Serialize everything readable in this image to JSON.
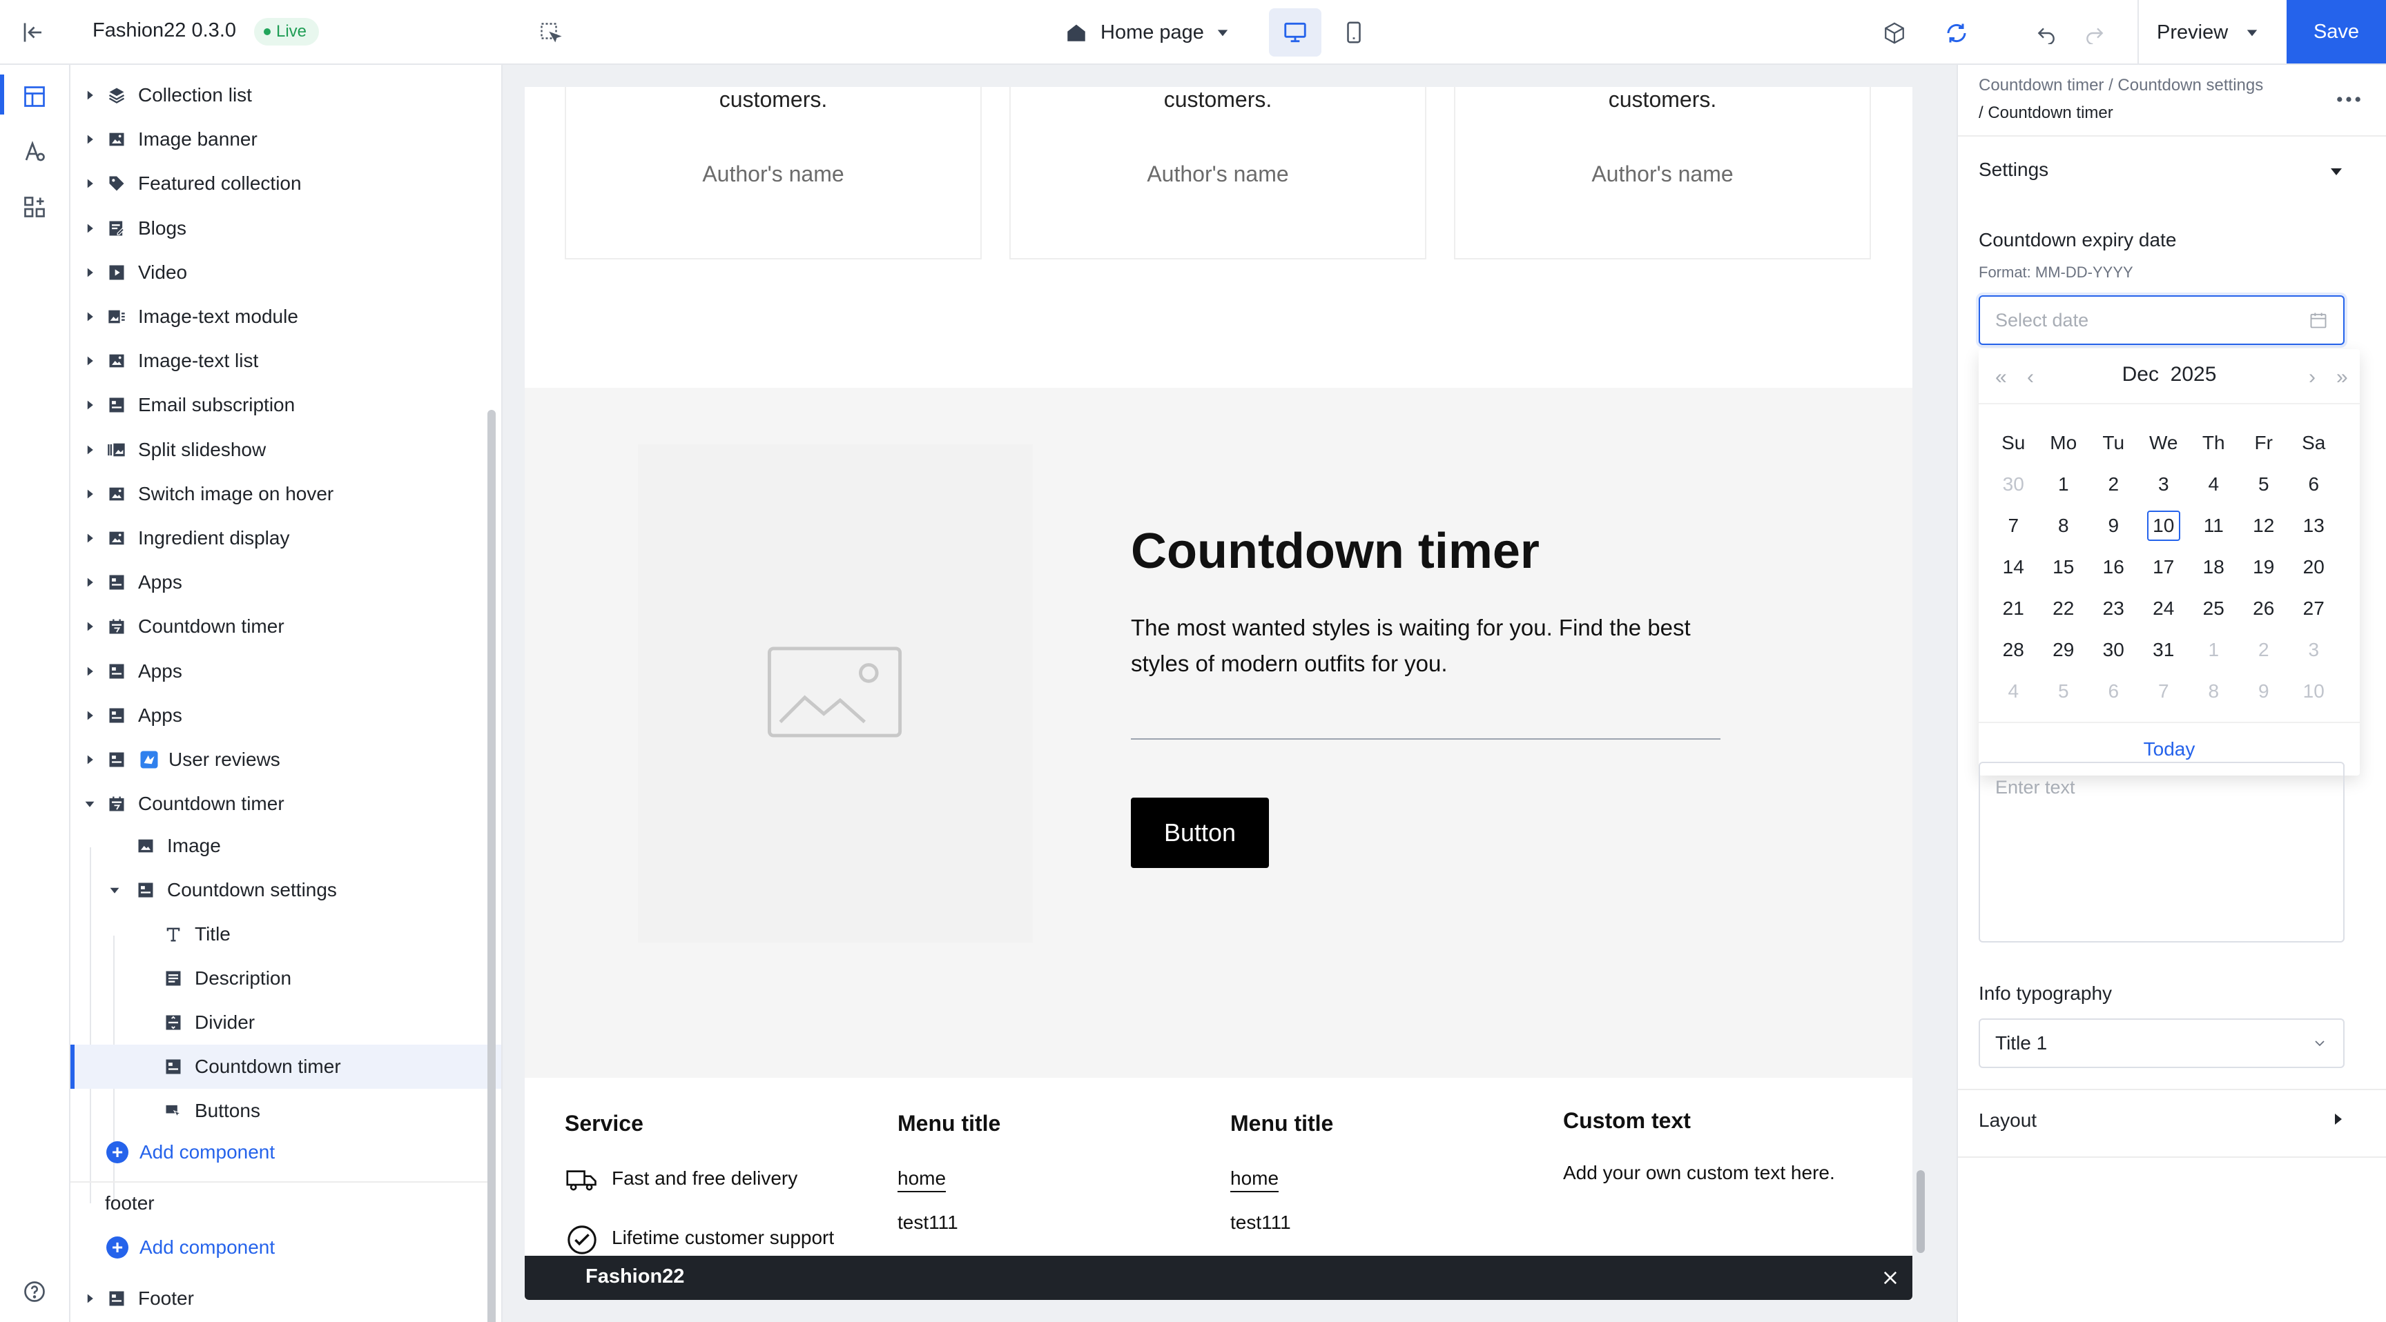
{
  "app": {
    "store_name": "Fashion22",
    "version": "0.3.0",
    "status": "Live",
    "page_selector": "Home page",
    "preview_label": "Preview",
    "save_label": "Save"
  },
  "layers": {
    "items": [
      {
        "label": "Collection list",
        "icon": "collection-icon",
        "expanded": false
      },
      {
        "label": "Image banner",
        "icon": "image-icon",
        "expanded": false
      },
      {
        "label": "Featured collection",
        "icon": "tag-icon",
        "expanded": false
      },
      {
        "label": "Blogs",
        "icon": "blog-icon",
        "expanded": false
      },
      {
        "label": "Video",
        "icon": "video-icon",
        "expanded": false
      },
      {
        "label": "Image-text module",
        "icon": "image-text-icon",
        "expanded": false
      },
      {
        "label": "Image-text list",
        "icon": "image-icon",
        "expanded": false
      },
      {
        "label": "Email subscription",
        "icon": "section-icon",
        "expanded": false
      },
      {
        "label": "Split slideshow",
        "icon": "slideshow-icon",
        "expanded": false
      },
      {
        "label": "Switch image on hover",
        "icon": "image-icon",
        "expanded": false
      },
      {
        "label": "Ingredient display",
        "icon": "image-icon",
        "expanded": false
      },
      {
        "label": "Apps",
        "icon": "section-icon",
        "expanded": false
      },
      {
        "label": "Countdown timer",
        "icon": "calendar-icon",
        "expanded": false
      },
      {
        "label": "Apps",
        "icon": "section-icon",
        "expanded": false
      },
      {
        "label": "Apps",
        "icon": "section-icon",
        "expanded": false
      },
      {
        "label": "User reviews",
        "icon": "section-icon",
        "expanded": false
      },
      {
        "label": "Countdown timer",
        "icon": "calendar-icon",
        "expanded": true
      }
    ],
    "children": {
      "image": "Image",
      "countdown_settings": "Countdown settings",
      "title": "Title",
      "description": "Description",
      "divider": "Divider",
      "countdown_timer": "Countdown timer",
      "buttons": "Buttons"
    },
    "add_component": "Add component",
    "footer_group": "footer",
    "footer_item": "Footer"
  },
  "canvas": {
    "quotes": [
      {
        "text": "customers.",
        "author": "Author's name"
      },
      {
        "text": "customers.",
        "author": "Author's name"
      },
      {
        "text": "customers.",
        "author": "Author's name"
      }
    ],
    "countdown": {
      "title": "Countdown timer",
      "description": "The most wanted styles is waiting for you. Find the best styles of modern outfits for you.",
      "button": "Button"
    },
    "footer": {
      "service_title": "Service",
      "service_items": [
        "Fast and free delivery",
        "Lifetime customer support"
      ],
      "menu1_title": "Menu title",
      "menu1_links": [
        "home",
        "test111"
      ],
      "menu2_title": "Menu title",
      "menu2_links": [
        "home",
        "test111"
      ],
      "custom_title": "Custom text",
      "custom_text": "Add your own custom text here."
    },
    "toast_title": "Fashion22"
  },
  "settings": {
    "breadcrumb_line1": "Countdown timer / Countdown settings",
    "breadcrumb_line2": "/ Countdown timer",
    "section_settings": "Settings",
    "expiry_label": "Countdown expiry date",
    "expiry_format": "Format: MM-DD-YYYY",
    "date_placeholder": "Select date",
    "datepicker": {
      "month": "Dec",
      "year": "2025",
      "weekdays": [
        "Su",
        "Mo",
        "Tu",
        "We",
        "Th",
        "Fr",
        "Sa"
      ],
      "weeks": [
        [
          {
            "d": "30",
            "m": true
          },
          {
            "d": "1"
          },
          {
            "d": "2"
          },
          {
            "d": "3"
          },
          {
            "d": "4"
          },
          {
            "d": "5"
          },
          {
            "d": "6"
          }
        ],
        [
          {
            "d": "7"
          },
          {
            "d": "8"
          },
          {
            "d": "9"
          },
          {
            "d": "10",
            "t": true
          },
          {
            "d": "11"
          },
          {
            "d": "12"
          },
          {
            "d": "13"
          }
        ],
        [
          {
            "d": "14"
          },
          {
            "d": "15"
          },
          {
            "d": "16"
          },
          {
            "d": "17"
          },
          {
            "d": "18"
          },
          {
            "d": "19"
          },
          {
            "d": "20"
          }
        ],
        [
          {
            "d": "21"
          },
          {
            "d": "22"
          },
          {
            "d": "23"
          },
          {
            "d": "24"
          },
          {
            "d": "25"
          },
          {
            "d": "26"
          },
          {
            "d": "27"
          }
        ],
        [
          {
            "d": "28"
          },
          {
            "d": "29"
          },
          {
            "d": "30"
          },
          {
            "d": "31"
          },
          {
            "d": "1",
            "m": true
          },
          {
            "d": "2",
            "m": true
          },
          {
            "d": "3",
            "m": true
          }
        ],
        [
          {
            "d": "4",
            "m": true
          },
          {
            "d": "5",
            "m": true
          },
          {
            "d": "6",
            "m": true
          },
          {
            "d": "7",
            "m": true
          },
          {
            "d": "8",
            "m": true
          },
          {
            "d": "9",
            "m": true
          },
          {
            "d": "10",
            "m": true
          }
        ]
      ],
      "today_label": "Today"
    },
    "text_placeholder": "Enter text",
    "info_typography_label": "Info typography",
    "info_typography_value": "Title 1",
    "section_layout": "Layout"
  },
  "colors": {
    "accent": "#2563eb",
    "live_green": "#22a55b",
    "dark_toast": "#1f2329"
  }
}
